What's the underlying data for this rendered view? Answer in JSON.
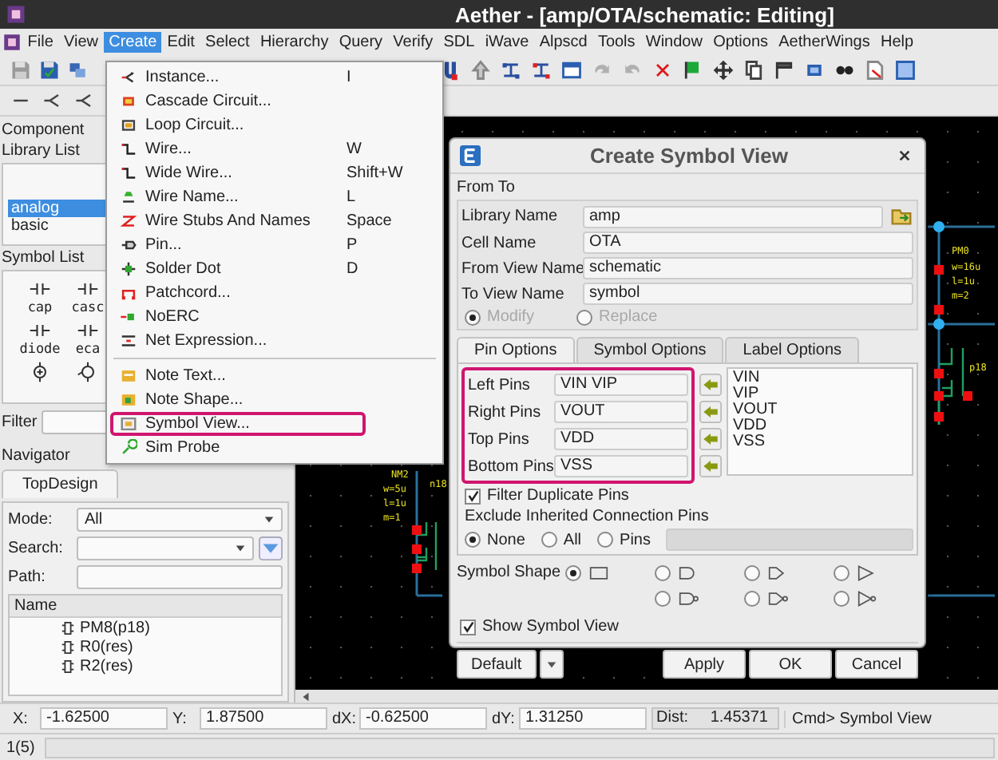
{
  "window": {
    "title": "Aether - [amp/OTA/schematic: Editing]"
  },
  "menubar": [
    {
      "label": "File",
      "selected": false
    },
    {
      "label": "View",
      "selected": false
    },
    {
      "label": "Create",
      "selected": true
    },
    {
      "label": "Edit",
      "selected": false
    },
    {
      "label": "Select",
      "selected": false
    },
    {
      "label": "Hierarchy",
      "selected": false
    },
    {
      "label": "Query",
      "selected": false
    },
    {
      "label": "Verify",
      "selected": false
    },
    {
      "label": "SDL",
      "selected": false
    },
    {
      "label": "iWave",
      "selected": false
    },
    {
      "label": "Alpscd",
      "selected": false
    },
    {
      "label": "Tools",
      "selected": false
    },
    {
      "label": "Window",
      "selected": false
    },
    {
      "label": "Options",
      "selected": false
    },
    {
      "label": "AetherWings",
      "selected": false
    },
    {
      "label": "Help",
      "selected": false
    }
  ],
  "create_menu": {
    "groups": [
      [
        {
          "label": "Instance...",
          "shortcut": "I",
          "highlighted": false
        },
        {
          "label": "Cascade Circuit...",
          "highlighted": false
        },
        {
          "label": "Loop Circuit...",
          "highlighted": false
        },
        {
          "label": "Wire...",
          "shortcut": "W",
          "highlighted": false
        },
        {
          "label": "Wide Wire...",
          "shortcut": "Shift+W",
          "highlighted": false
        },
        {
          "label": "Wire Name...",
          "shortcut": "L",
          "highlighted": false
        },
        {
          "label": "Wire Stubs And Names",
          "shortcut": "Space",
          "highlighted": false
        },
        {
          "label": "Pin...",
          "shortcut": "P",
          "highlighted": false
        },
        {
          "label": "Solder Dot",
          "shortcut": "D",
          "highlighted": false
        },
        {
          "label": "Patchcord...",
          "highlighted": false
        },
        {
          "label": "NoERC",
          "highlighted": false
        },
        {
          "label": "Net Expression...",
          "highlighted": false
        }
      ],
      [
        {
          "label": "Note Text...",
          "highlighted": false
        },
        {
          "label": "Note Shape...",
          "highlighted": false
        },
        {
          "label": "Symbol View...",
          "highlighted": true
        },
        {
          "label": "Sim Probe",
          "highlighted": false
        }
      ]
    ]
  },
  "left_panel": {
    "title": "Component",
    "library_list": {
      "label": "Library List",
      "items": [
        {
          "label": "analog",
          "selected": true
        },
        {
          "label": "basic",
          "selected": false
        }
      ]
    },
    "symbol_list": {
      "label": "Symbol List",
      "items": [
        "cap",
        "casc",
        "diode",
        "eca"
      ]
    },
    "filter": {
      "label": "Filter"
    }
  },
  "navigator": {
    "title": "Navigator",
    "tabs": [
      {
        "label": "TopDesign",
        "selected": true
      }
    ],
    "mode": {
      "label": "Mode:",
      "value": "All"
    },
    "search": {
      "label": "Search:"
    },
    "path": {
      "label": "Path:"
    },
    "tree": {
      "column": "Name",
      "rows": [
        "PM8(p18)",
        "R0(res)",
        "R2(res)"
      ]
    }
  },
  "schematic": {
    "labels": [
      "PM0",
      "w=16u",
      "l=1u",
      "m=2",
      "p18",
      "NM2",
      "w=5u",
      "l=1u",
      "m=1",
      "n18"
    ]
  },
  "dialog": {
    "title": "Create Symbol View",
    "group": "From To",
    "fields": [
      {
        "label": "Library Name",
        "value": "amp"
      },
      {
        "label": "Cell Name",
        "value": "OTA"
      },
      {
        "label": "From View Name",
        "value": "schematic"
      },
      {
        "label": "To View Name",
        "value": "symbol"
      }
    ],
    "mode_options": [
      {
        "label": "Modify",
        "selected": true,
        "disabled": true
      },
      {
        "label": "Replace",
        "selected": false,
        "disabled": true
      }
    ],
    "tabs": [
      {
        "label": "Pin Options",
        "selected": true
      },
      {
        "label": "Symbol Options",
        "selected": false
      },
      {
        "label": "Label Options",
        "selected": false
      }
    ],
    "pins_highlighted": true,
    "pins": [
      {
        "label": "Left Pins",
        "value": "VIN VIP"
      },
      {
        "label": "Right Pins",
        "value": "VOUT"
      },
      {
        "label": "Top Pins",
        "value": "VDD"
      },
      {
        "label": "Bottom Pins",
        "value": "VSS"
      }
    ],
    "pin_list": [
      "VIN",
      "VIP",
      "VOUT",
      "VDD",
      "VSS"
    ],
    "filter_duplicates": {
      "label": "Filter Duplicate Pins",
      "checked": true
    },
    "exclude": {
      "label": "Exclude Inherited Connection Pins",
      "options": [
        {
          "label": "None",
          "selected": true
        },
        {
          "label": "All",
          "selected": false
        },
        {
          "label": "Pins",
          "selected": false
        }
      ]
    },
    "symbol_shape": {
      "label": "Symbol Shape",
      "options": [
        {
          "kind": "rectangle",
          "selected": true
        },
        {
          "kind": "and",
          "selected": false
        },
        {
          "kind": "or",
          "selected": false
        },
        {
          "kind": "buffer",
          "selected": false
        },
        {
          "kind": "and_bubble",
          "selected": false
        },
        {
          "kind": "or_bubble",
          "selected": false
        },
        {
          "kind": "buffer_bubble",
          "selected": false
        }
      ]
    },
    "show_symbol": {
      "label": "Show Symbol View",
      "checked": true
    },
    "buttons": [
      "Default",
      "Apply",
      "OK",
      "Cancel"
    ]
  },
  "status_bar": {
    "x": {
      "label": "X:",
      "value": "-1.62500"
    },
    "y": {
      "label": "Y:",
      "value": "1.87500"
    },
    "dx": {
      "label": "dX:",
      "value": "-0.62500"
    },
    "dy": {
      "label": "dY:",
      "value": "1.31250"
    },
    "dist": {
      "label": "Dist:",
      "value": "1.45371"
    },
    "cmd": "Cmd>  Symbol View"
  },
  "footer": {
    "page": "1(5)"
  }
}
